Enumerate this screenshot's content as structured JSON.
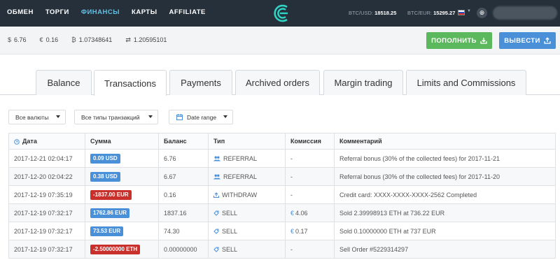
{
  "nav": {
    "items": [
      "ОБМЕН",
      "ТОРГИ",
      "ФИНАНСЫ",
      "КАРТЫ",
      "AFFILIATE"
    ],
    "active": "ФИНАНСЫ"
  },
  "rates": {
    "btc_usd_label": "BTC/USD:",
    "btc_usd_value": "18518.25",
    "btc_eur_label": "BTC/EUR:",
    "btc_eur_value": "15295.27"
  },
  "balances": [
    {
      "symbol": "$",
      "value": "6.76"
    },
    {
      "symbol": "€",
      "value": "0.16"
    },
    {
      "symbol": "₿",
      "value": "1.07348641"
    },
    {
      "symbol": "⇄",
      "value": "1.20595101"
    }
  ],
  "actions": {
    "deposit_label": "ПОПОЛНИТЬ",
    "withdraw_label": "ВЫВЕСТИ"
  },
  "tabs": [
    "Balance",
    "Transactions",
    "Payments",
    "Archived orders",
    "Margin trading",
    "Limits and Commissions"
  ],
  "active_tab": "Transactions",
  "filters": {
    "currency": "Все валюты",
    "type": "Все типы транзакций",
    "date": "Date range"
  },
  "table": {
    "headers": [
      "Дата",
      "Сумма",
      "Баланс",
      "Тип",
      "Комиссия",
      "Комментарий"
    ],
    "rows": [
      {
        "date": "2017-12-21 02:04:17",
        "amount": "0.09 USD",
        "sign": "pos",
        "balance": "6.76",
        "type": "REFERRAL",
        "type_icon": "users-icon",
        "fee": "-",
        "comment": "Referral bonus (30% of the collected fees) for 2017-11-21"
      },
      {
        "date": "2017-12-20 02:04:22",
        "amount": "0.38 USD",
        "sign": "pos",
        "balance": "6.67",
        "type": "REFERRAL",
        "type_icon": "users-icon",
        "fee": "-",
        "comment": "Referral bonus (30% of the collected fees) for 2017-11-20"
      },
      {
        "date": "2017-12-19 07:35:19",
        "amount": "-1837.00 EUR",
        "sign": "neg",
        "balance": "0.16",
        "type": "WITHDRAW",
        "type_icon": "upload-icon",
        "fee": "-",
        "comment": "Credit card: XXXX-XXXX-XXXX-2562 Completed"
      },
      {
        "date": "2017-12-19 07:32:17",
        "amount": "1762.86 EUR",
        "sign": "pos",
        "balance": "1837.16",
        "type": "SELL",
        "type_icon": "tag-icon",
        "fee": "4.06",
        "comment": "Sold 2.39998913 ETH at 736.22 EUR"
      },
      {
        "date": "2017-12-19 07:32:17",
        "amount": "73.53 EUR",
        "sign": "pos",
        "balance": "74.30",
        "type": "SELL",
        "type_icon": "tag-icon",
        "fee": "0.17",
        "comment": "Sold 0.10000000 ETH at 737 EUR"
      },
      {
        "date": "2017-12-19 07:32:17",
        "amount": "-2.50000000 ETH",
        "sign": "neg",
        "balance": "0.00000000",
        "type": "SELL",
        "type_icon": "tag-icon",
        "fee": "-",
        "comment": "Sell Order #5229314297"
      }
    ]
  },
  "colors": {
    "topbar": "#26303b",
    "nav_active": "#5fc1e4",
    "deposit": "#5cb85c",
    "withdraw": "#4a90d9",
    "badge_positive": "#4a90d9",
    "badge_negative": "#c9302c"
  }
}
